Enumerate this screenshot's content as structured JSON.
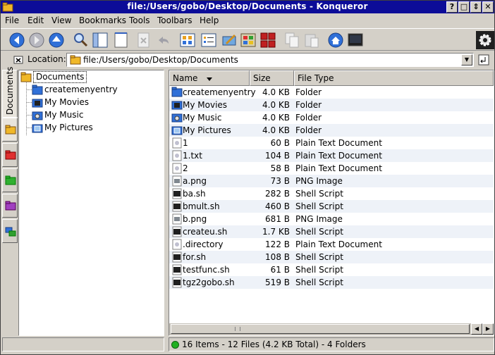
{
  "window": {
    "title": "file:/Users/gobo/Desktop/Documents - Konqueror",
    "buttons": [
      "?",
      "□",
      "⇕",
      "✕"
    ]
  },
  "menu": [
    "File",
    "Edit",
    "View",
    "Bookmarks",
    "Tools",
    "Toolbars",
    "Help"
  ],
  "toolbar": {
    "icons": [
      "back-icon",
      "forward-icon",
      "up-icon",
      "find-icon",
      "split-view-icon",
      "new-view-icon",
      "stop-icon",
      "undo-icon",
      "icon-view-icon",
      "detailed-view-icon",
      "edit-icon",
      "desktop-icon",
      "apps-icon",
      "copy-icon",
      "paste-icon",
      "home-icon",
      "terminal-icon",
      "activity-gear-icon"
    ]
  },
  "location": {
    "label": "Location:",
    "value": "file:/Users/gobo/Desktop/Documents"
  },
  "sidebar": {
    "tab_label": "Documents",
    "tree": [
      {
        "label": "Documents",
        "root": true
      },
      {
        "label": "createmenyentry"
      },
      {
        "label": "My Movies"
      },
      {
        "label": "My Music"
      },
      {
        "label": "My Pictures"
      }
    ]
  },
  "filelist": {
    "columns": [
      "Name",
      "Size",
      "File Type"
    ],
    "rows": [
      {
        "name": "createmenyentry",
        "size": "4.0 KB",
        "type": "Folder",
        "icon": "folder-icon"
      },
      {
        "name": "My Movies",
        "size": "4.0 KB",
        "type": "Folder",
        "icon": "movies-folder-icon"
      },
      {
        "name": "My Music",
        "size": "4.0 KB",
        "type": "Folder",
        "icon": "music-folder-icon"
      },
      {
        "name": "My Pictures",
        "size": "4.0 KB",
        "type": "Folder",
        "icon": "pictures-folder-icon"
      },
      {
        "name": "1",
        "size": "60 B",
        "type": "Plain Text Document",
        "icon": "text-file-icon"
      },
      {
        "name": "1.txt",
        "size": "104 B",
        "type": "Plain Text Document",
        "icon": "text-file-icon"
      },
      {
        "name": "2",
        "size": "58 B",
        "type": "Plain Text Document",
        "icon": "text-file-icon"
      },
      {
        "name": "a.png",
        "size": "73 B",
        "type": "PNG Image",
        "icon": "image-file-icon"
      },
      {
        "name": "ba.sh",
        "size": "282 B",
        "type": "Shell Script",
        "icon": "script-file-icon"
      },
      {
        "name": "bmult.sh",
        "size": "460 B",
        "type": "Shell Script",
        "icon": "script-file-icon"
      },
      {
        "name": "b.png",
        "size": "681 B",
        "type": "PNG Image",
        "icon": "image-file-icon"
      },
      {
        "name": "createu.sh",
        "size": "1.7 KB",
        "type": "Shell Script",
        "icon": "script-file-icon"
      },
      {
        "name": ".directory",
        "size": "122 B",
        "type": "Plain Text Document",
        "icon": "text-file-icon"
      },
      {
        "name": "for.sh",
        "size": "108 B",
        "type": "Shell Script",
        "icon": "script-file-icon"
      },
      {
        "name": "testfunc.sh",
        "size": "61 B",
        "type": "Shell Script",
        "icon": "script-file-icon"
      },
      {
        "name": "tgz2gobo.sh",
        "size": "519 B",
        "type": "Shell Script",
        "icon": "script-file-icon"
      }
    ]
  },
  "status": {
    "text": "16 Items - 12 Files (4.2 KB Total) - 4 Folders"
  },
  "colors": {
    "titlebar": "#0c0c98",
    "window_bg": "#d4d0c8",
    "alt_row": "#eef2f8",
    "folder": "#f0b828"
  }
}
